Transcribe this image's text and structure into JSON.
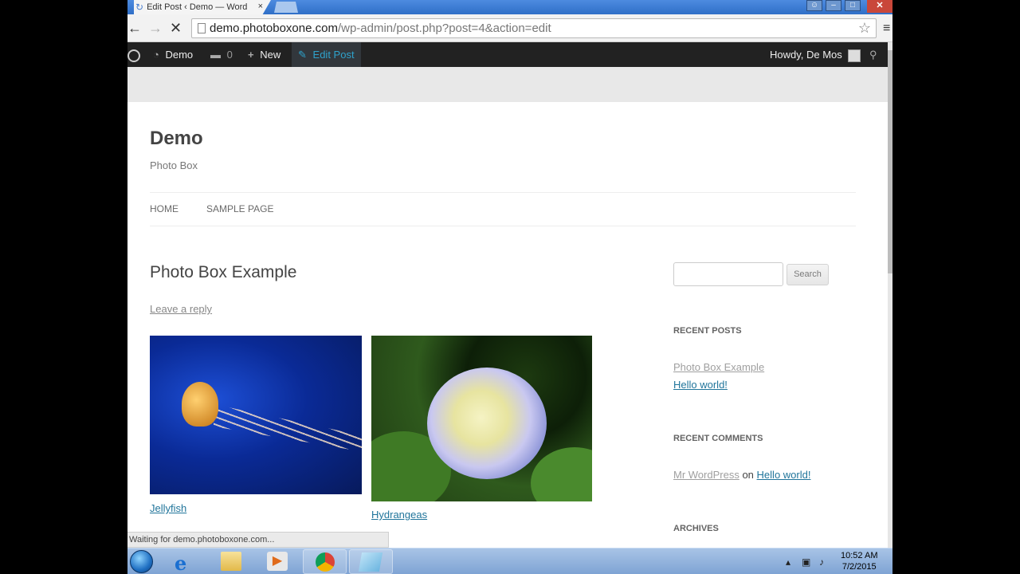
{
  "browser": {
    "tab_title": "Edit Post ‹ Demo — Word",
    "tab_close": "×",
    "url_host": "demo.photoboxone.com",
    "url_path": "/wp-admin/post.php?post=4&action=edit"
  },
  "adminbar": {
    "site_name": "Demo",
    "comments_count": "0",
    "new_label": "New",
    "edit_post_label": "Edit Post",
    "howdy": "Howdy, De Mos"
  },
  "site": {
    "title": "Demo",
    "description": "Photo Box",
    "nav": [
      "HOME",
      "SAMPLE PAGE"
    ]
  },
  "post": {
    "title": "Photo Box Example",
    "leave_reply": "Leave a reply",
    "gallery": [
      {
        "caption": "Jellyfish"
      },
      {
        "caption": "Hydrangeas"
      }
    ]
  },
  "sidebar": {
    "search_button": "Search",
    "search_placeholder": "",
    "recent_posts_title": "RECENT POSTS",
    "recent_posts": [
      "Photo Box Example",
      "Hello world!"
    ],
    "recent_comments_title": "RECENT COMMENTS",
    "comment_author": "Mr WordPress",
    "comment_on": "on",
    "comment_post": "Hello world!",
    "archives_title": "ARCHIVES"
  },
  "status_text": "Waiting for demo.photoboxone.com...",
  "taskbar": {
    "time": "10:52 AM",
    "date": "7/2/2015"
  },
  "colors": {
    "link": "#21759b",
    "adminbar": "#222222",
    "edit_post_accent": "#2ea2cc"
  }
}
